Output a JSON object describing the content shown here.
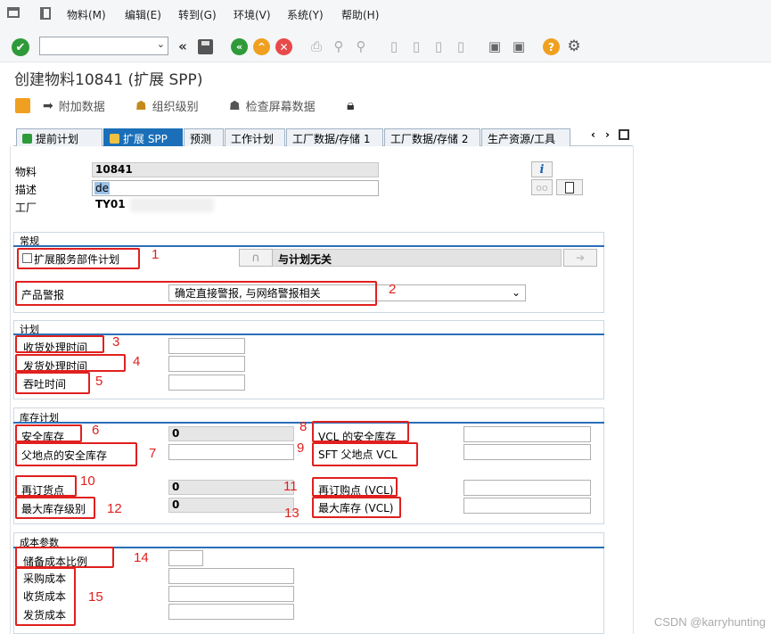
{
  "menu": {
    "items": [
      "物料(M)",
      "编辑(E)",
      "转到(G)",
      "环境(V)",
      "系统(Y)",
      "帮助(H)"
    ]
  },
  "window_title": "创建物料10841 (扩展 SPP)",
  "app_toolbar": {
    "additional_data": "附加数据",
    "org_levels": "组织级别",
    "check_screen_data": "检查屏幕数据"
  },
  "tabs": [
    "提前计划",
    "扩展 SPP",
    "预测",
    "工作计划",
    "工厂数据/存储 1",
    "工厂数据/存储 2",
    "生产资源/工具"
  ],
  "header": {
    "material_label": "物料",
    "material_value": "10841",
    "description_label": "描述",
    "description_value": "de",
    "plant_label": "工厂",
    "plant_value": "TY01"
  },
  "general": {
    "title": "常规",
    "extend_service_parts_label": "扩展服务部件计划",
    "not_related_to_planning": "与计划无关",
    "product_alert_label": "产品警报",
    "product_alert_value": "确定直接警报, 与网络警报相关"
  },
  "planning": {
    "title": "计划",
    "gr_processing_time": "收货处理时间",
    "gi_processing_time": "发货处理时间",
    "throughput_time": "吞吐时间"
  },
  "stock_planning": {
    "title": "库存计划",
    "safety_stock_label": "安全库存",
    "safety_stock_value": "0",
    "parent_safety_stock_label": "父地点的安全库存",
    "reorder_point_label": "再订货点",
    "reorder_point_value": "0",
    "max_stock_level_label": "最大库存级别",
    "max_stock_level_value": "0",
    "vcl_safety_stock_label": "VCL 的安全库存",
    "sft_parent_vcl_label": "SFT 父地点 VCL",
    "reorder_point_vcl_label": "再订购点 (VCL)",
    "max_stock_vcl_label": "最大库存 (VCL)"
  },
  "cost_params": {
    "title": "成本参数",
    "storage_cost_pct": "储备成本比例",
    "procurement_cost": "采购成本",
    "gr_cost": "收货成本",
    "gi_cost": "发货成本"
  },
  "annotations": [
    "1",
    "2",
    "3",
    "4",
    "5",
    "6",
    "7",
    "8",
    "9",
    "10",
    "11",
    "12",
    "13",
    "14",
    "15"
  ],
  "watermark": "CSDN @karryhunting",
  "colors": {
    "tab_active": "#1a6fb8",
    "annotation_red": "#e0201e",
    "group_line": "#2a6fb8"
  }
}
